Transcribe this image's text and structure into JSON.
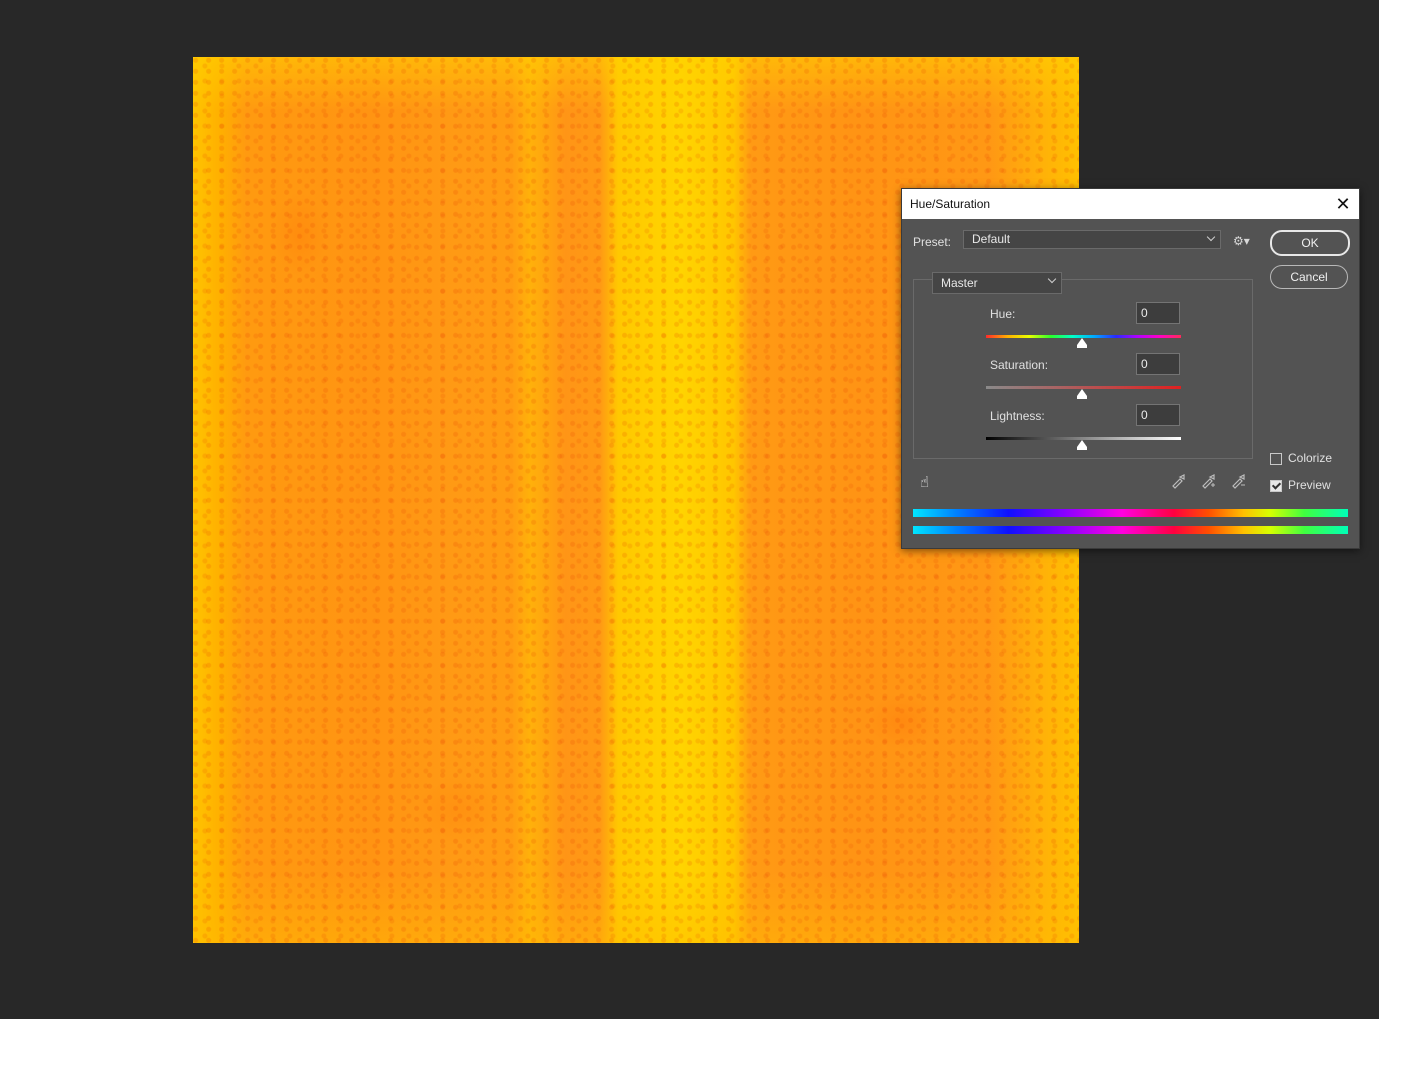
{
  "dialog": {
    "title": "Hue/Saturation",
    "close_glyph": "✕"
  },
  "preset": {
    "label": "Preset:",
    "value": "Default"
  },
  "buttons": {
    "ok": "OK",
    "cancel": "Cancel"
  },
  "edit": {
    "value": "Master"
  },
  "hue": {
    "label": "Hue:",
    "value": "0"
  },
  "saturation": {
    "label": "Saturation:",
    "value": "0"
  },
  "lightness": {
    "label": "Lightness:",
    "value": "0"
  },
  "options": {
    "colorize": {
      "label": "Colorize",
      "checked": false
    },
    "preview": {
      "label": "Preview",
      "checked": true
    }
  },
  "icons": {
    "gear": "⚙",
    "hand": "☝",
    "eyedropper": "⁄",
    "eyedropper_plus": "⁄",
    "eyedropper_minus": "⁄"
  },
  "colors": {
    "workspace": "#282828",
    "dialog_bg": "#535353",
    "image_primary": "#ff9a14",
    "image_highlight": "#ffd400"
  }
}
